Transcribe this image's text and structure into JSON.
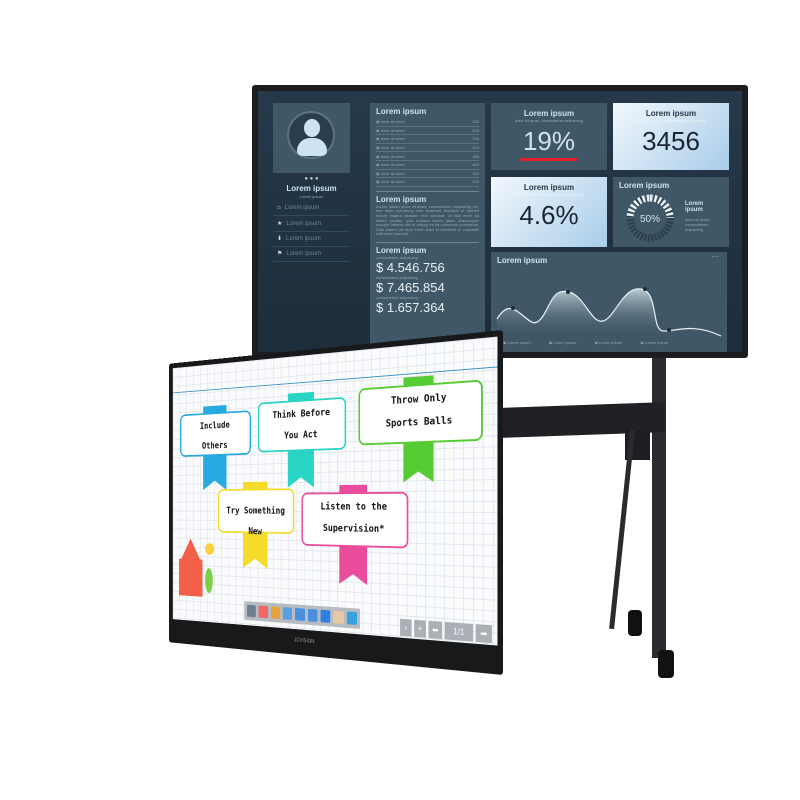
{
  "dashboard": {
    "profile": {
      "name": "Lorem ipsum",
      "subtitle": "Lorem ipsum",
      "nav": [
        {
          "icon": "home-icon",
          "label": "Lorem ipsum"
        },
        {
          "icon": "star-icon",
          "label": "Lorem ipsum"
        },
        {
          "icon": "download-icon",
          "label": "Lorem ipsum"
        },
        {
          "icon": "flag-icon",
          "label": "Lorem ipsum"
        }
      ]
    },
    "list": {
      "title": "Lorem ipsum",
      "items": [
        {
          "label": "dolor sit amet",
          "value": "142"
        },
        {
          "label": "dolor sit amet",
          "value": "543"
        },
        {
          "label": "dolor sit amet",
          "value": "376"
        },
        {
          "label": "dolor sit amet",
          "value": "214"
        },
        {
          "label": "dolor sit amet",
          "value": "456"
        },
        {
          "label": "dolor sit amet",
          "value": "653"
        },
        {
          "label": "dolor sit amet",
          "value": "342"
        },
        {
          "label": "dolor sit amet",
          "value": "243"
        }
      ]
    },
    "text": {
      "title": "Lorem ipsum",
      "body": "Lorem ipsum dolor sit amet, consectetuer adipiscing elit, sed diam nonummy nibh euismod tincidunt ut laoreet dolore magna aliquam erat volutpat. Ut wisi enim ad minim veniam, quis nostrud exerci tation ullamcorper suscipit lobortis nisl ut aliquip ex ea commodo consequat. Duis autem vel eum iriure dolor in hendrerit in vulputate velit esse molestie"
    },
    "money": {
      "title": "Lorem ipsum",
      "caption": "consectetuer adipiscing",
      "values": [
        "$ 4.546.756",
        "$ 7.465.854",
        "$ 1.657.364"
      ]
    },
    "stats": [
      {
        "title": "Lorem ipsum",
        "caption": "dolor sit amet, consectetuer adipiscing",
        "value": "19%"
      },
      {
        "title": "Lorem ipsum",
        "caption": "dolor sit amet, consectetuer adipiscing",
        "value": "3456"
      },
      {
        "title": "Lorem ipsum",
        "caption": "dolor sit amet, consectetuer adipiscing",
        "value": "4.6%"
      }
    ],
    "gauge": {
      "title": "Lorem ipsum",
      "value": "50%",
      "fraction": 0.5,
      "label": "Lorem ipsum",
      "caption": "dolor sit amet, consectetuer adipiscing"
    },
    "chart": {
      "title": "Lorem ipsum",
      "legend": [
        "Lorem ipsum",
        "Lorem ipsum",
        "Lorem ipsum",
        "Lorem ipsum"
      ]
    },
    "colors": {
      "accent": "#e0202a",
      "bg": "#22364a",
      "panel": "#3f5766"
    }
  },
  "whiteboard": {
    "notes": [
      {
        "line1": "Include",
        "line2": "Others",
        "color": "#27a9e1"
      },
      {
        "line1": "Think Before",
        "line2": "You Act",
        "color": "#2ad4c4"
      },
      {
        "line1": "Throw Only",
        "line2": "Sports Balls",
        "color": "#55cc33"
      },
      {
        "line1": "Try Something New",
        "line2": "",
        "color": "#f5dc2a"
      },
      {
        "line1": "Listen to the",
        "line2": "Supervision*",
        "color": "#ea4d9c"
      }
    ],
    "toolbar": [
      "pen-icon",
      "eraser-icon",
      "color-palette-icon",
      "shapes-icon",
      "undo-icon",
      "redo-icon",
      "select-icon",
      "hand-icon",
      "trash-icon"
    ],
    "page_indicator": "1/1",
    "brand": "JCVISION"
  }
}
